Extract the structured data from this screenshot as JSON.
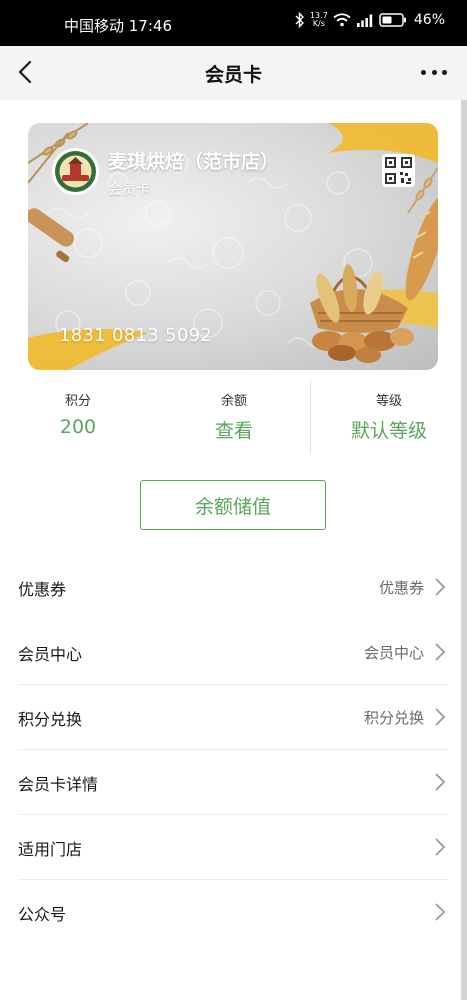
{
  "status_bar": {
    "carrier_time": "中国移动 17:46",
    "speed_value": "13.7",
    "speed_unit": "K/s",
    "battery": "46%"
  },
  "nav": {
    "title": "会员卡"
  },
  "card": {
    "shop_name": "麦琪烘焙（范市店）",
    "card_type": "会员卡",
    "number": "1831 0813 5092",
    "logo_text": "Magic Baking"
  },
  "stats": [
    {
      "label": "积分",
      "value": "200"
    },
    {
      "label": "余额",
      "value": "查看"
    },
    {
      "label": "等级",
      "value": "默认等级"
    }
  ],
  "recharge_label": "余额储值",
  "menu": [
    {
      "label": "优惠券",
      "value": "优惠券"
    },
    {
      "label": "会员中心",
      "value": "会员中心"
    },
    {
      "label": "积分兑换",
      "value": "积分兑换"
    },
    {
      "label": "会员卡详情",
      "value": ""
    },
    {
      "label": "适用门店",
      "value": ""
    },
    {
      "label": "公众号",
      "value": ""
    }
  ],
  "colors": {
    "accent_green": "#5aa55a",
    "status_bar": "#000000",
    "nav_bg": "#f4f4f4"
  },
  "icons": [
    "back-arrow-icon",
    "more-dots-icon",
    "bluetooth-icon",
    "wifi-icon",
    "signal-icon",
    "battery-icon",
    "qr-code-icon",
    "chevron-right-icon"
  ]
}
